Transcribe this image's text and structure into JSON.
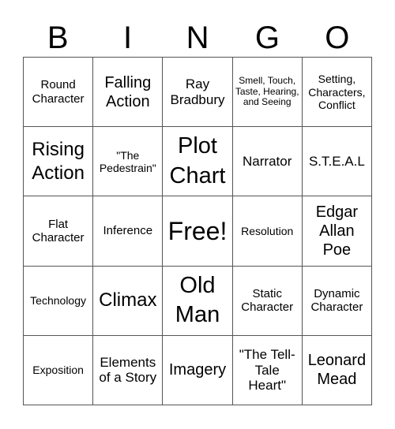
{
  "header": {
    "letters": [
      "B",
      "I",
      "N",
      "G",
      "O"
    ]
  },
  "grid": {
    "rows": [
      [
        "Round Character",
        "Falling Action",
        "Ray Bradbury",
        "Smell, Touch, Taste, Hearing, and Seeing",
        "Setting, Characters, Conflict"
      ],
      [
        "Rising Action",
        "\"The Pedestrain\"",
        "Plot Chart",
        "Narrator",
        "S.T.E.A.L"
      ],
      [
        "Flat Character",
        "Inference",
        "Free!",
        "Resolution",
        "Edgar Allan Poe"
      ],
      [
        "Technology",
        "Climax",
        "Old Man",
        "Static Character",
        "Dynamic Character"
      ],
      [
        "Exposition",
        "Elements of a Story",
        "Imagery",
        "\"The Tell-Tale Heart\"",
        "Leonard Mead"
      ]
    ]
  }
}
